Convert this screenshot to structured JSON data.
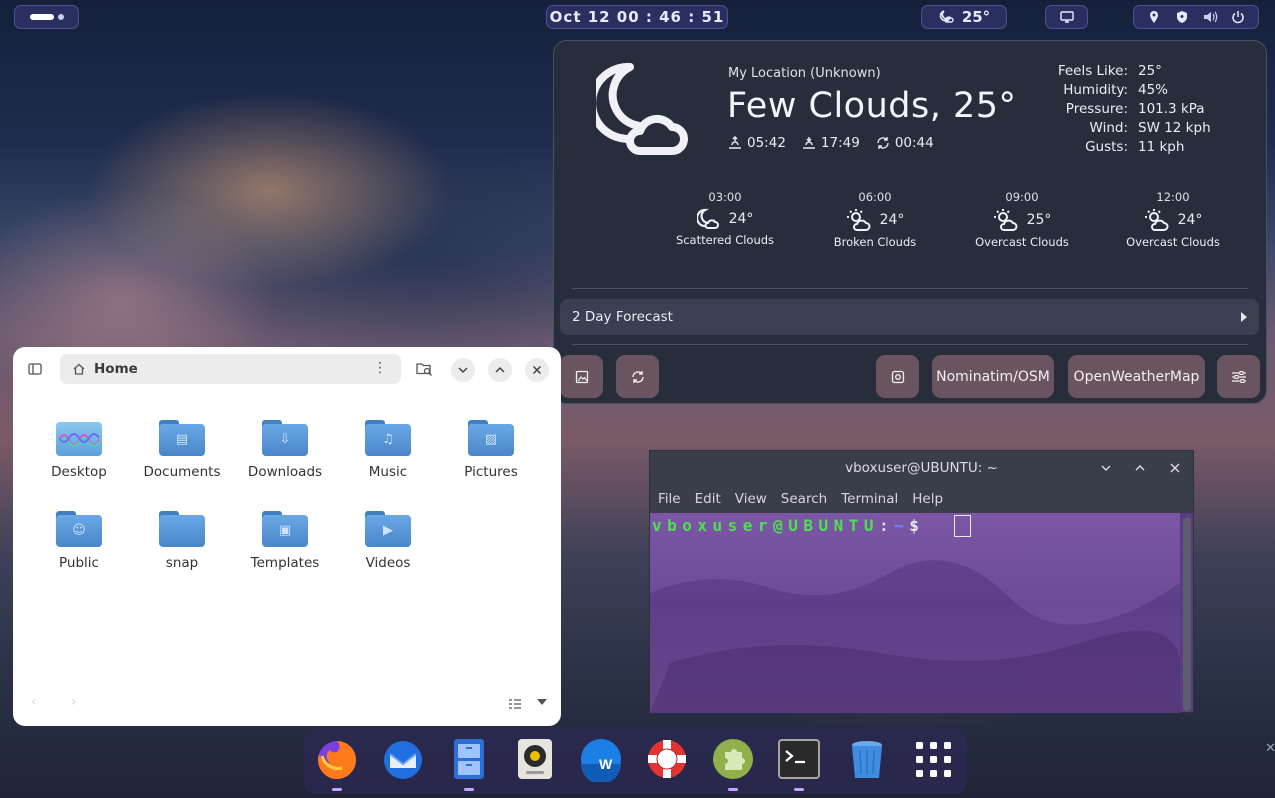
{
  "topbar": {
    "clock": "Oct 12  00 : 46 : 51",
    "weather_temp": "25°"
  },
  "weather": {
    "location": "My Location (Unknown)",
    "summary": "Few Clouds, 25°",
    "sunrise": "05:42",
    "sunset": "17:49",
    "refreshed": "00:44",
    "details": [
      {
        "label": "Feels Like:",
        "value": "25°"
      },
      {
        "label": "Humidity:",
        "value": "45%"
      },
      {
        "label": "Pressure:",
        "value": "101.3 kPa"
      },
      {
        "label": "Wind:",
        "value": "SW 12 kph"
      },
      {
        "label": "Gusts:",
        "value": "11 kph"
      }
    ],
    "hourly": [
      {
        "time": "03:00",
        "temp": "24°",
        "condition": "Scattered Clouds",
        "icon": "night-cloud-icon"
      },
      {
        "time": "06:00",
        "temp": "24°",
        "condition": "Broken Clouds",
        "icon": "sun-cloud-icon"
      },
      {
        "time": "09:00",
        "temp": "25°",
        "condition": "Overcast Clouds",
        "icon": "sun-cloud-icon"
      },
      {
        "time": "12:00",
        "temp": "24°",
        "condition": "Overcast Clouds",
        "icon": "sun-cloud-icon"
      }
    ],
    "forecast_label": "2 Day Forecast",
    "provider_geocode": "Nominatim/OSM",
    "provider_weather": "OpenWeatherMap"
  },
  "files": {
    "location": "Home",
    "items": [
      {
        "label": "Desktop",
        "icon": "desktop-folder-icon"
      },
      {
        "label": "Documents",
        "icon": "documents-folder-icon"
      },
      {
        "label": "Downloads",
        "icon": "downloads-folder-icon"
      },
      {
        "label": "Music",
        "icon": "music-folder-icon"
      },
      {
        "label": "Pictures",
        "icon": "pictures-folder-icon"
      },
      {
        "label": "Public",
        "icon": "public-folder-icon"
      },
      {
        "label": "snap",
        "icon": "folder-icon"
      },
      {
        "label": "Templates",
        "icon": "templates-folder-icon"
      },
      {
        "label": "Videos",
        "icon": "videos-folder-icon"
      }
    ]
  },
  "terminal": {
    "title": "vboxuser@UBUNTU: ~",
    "menu": [
      "File",
      "Edit",
      "View",
      "Search",
      "Terminal",
      "Help"
    ],
    "prompt_user": "vboxuser@UBUNTU",
    "prompt_sep": ":",
    "prompt_dir": "~",
    "prompt_sym": "$"
  },
  "dock": {
    "apps": [
      {
        "name": "firefox-icon",
        "running": true
      },
      {
        "name": "thunderbird-icon",
        "running": false
      },
      {
        "name": "files-icon",
        "running": true
      },
      {
        "name": "rhythmbox-icon",
        "running": false
      },
      {
        "name": "libreoffice-writer-icon",
        "running": false
      },
      {
        "name": "help-icon",
        "running": false
      },
      {
        "name": "extensions-icon",
        "running": true
      },
      {
        "name": "terminal-icon",
        "running": true
      },
      {
        "name": "trash-icon",
        "running": false
      },
      {
        "name": "app-grid-icon",
        "running": false
      }
    ]
  },
  "colors": {
    "accent": "#c6a3ff",
    "prompt_green": "#4ee04e",
    "prompt_blue": "#6f8cff"
  }
}
